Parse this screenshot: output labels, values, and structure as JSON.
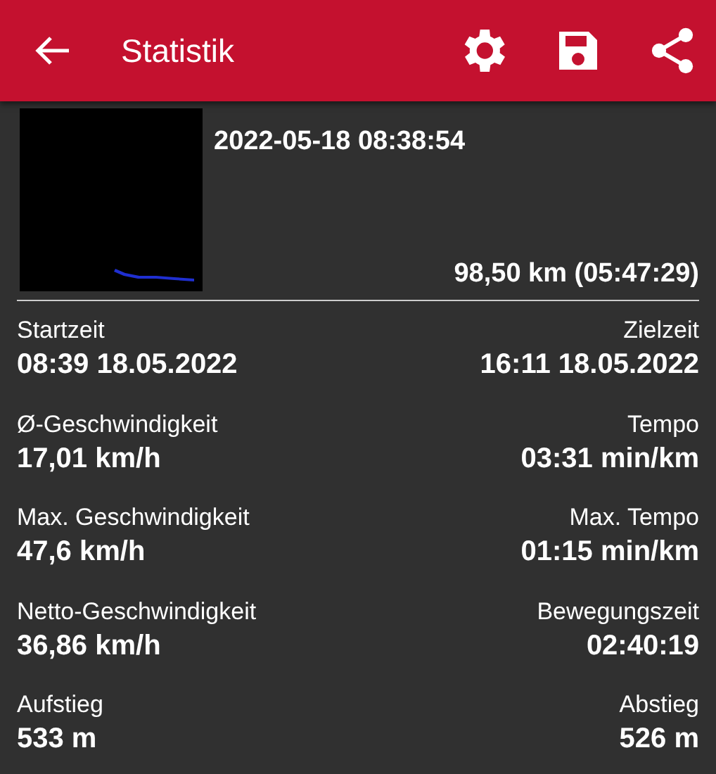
{
  "header": {
    "title": "Statistik"
  },
  "summary": {
    "date": "2022-05-18 08:38:54",
    "distance": "98,50 km (05:47:29)"
  },
  "rows": [
    {
      "left": {
        "label": "Startzeit",
        "value": "08:39 18.05.2022"
      },
      "right": {
        "label": "Zielzeit",
        "value": "16:11 18.05.2022"
      }
    },
    {
      "left": {
        "label": "Ø-Geschwindigkeit",
        "value": "17,01 km/h"
      },
      "right": {
        "label": "Tempo",
        "value": "03:31 min/km"
      }
    },
    {
      "left": {
        "label": "Max. Geschwindigkeit",
        "value": "47,6 km/h"
      },
      "right": {
        "label": "Max. Tempo",
        "value": "01:15 min/km"
      }
    },
    {
      "left": {
        "label": "Netto-Geschwindigkeit",
        "value": "36,86 km/h"
      },
      "right": {
        "label": "Bewegungszeit",
        "value": "02:40:19"
      }
    },
    {
      "left": {
        "label": "Aufstieg",
        "value": "533 m"
      },
      "right": {
        "label": "Abstieg",
        "value": "526 m"
      }
    }
  ]
}
